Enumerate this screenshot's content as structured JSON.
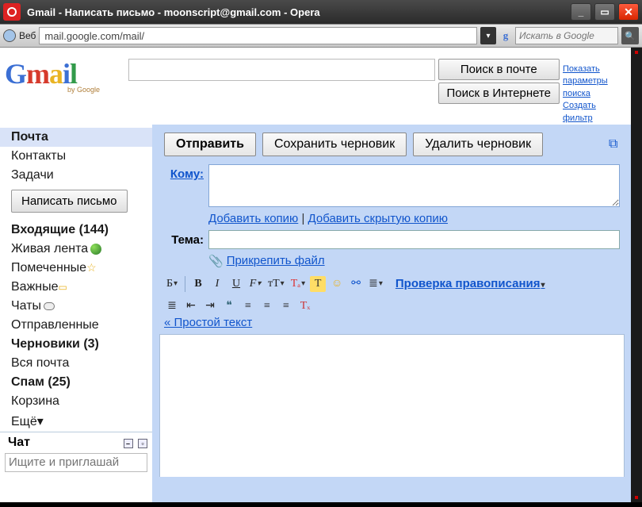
{
  "window": {
    "title": "Gmail - Написать письмо - moonscript@gmail.com - Opera"
  },
  "addressbar": {
    "label": "Веб",
    "url": "mail.google.com/mail/",
    "search_placeholder": "Искать в Google"
  },
  "logo": {
    "sub": "by Google"
  },
  "search_buttons": {
    "mail": "Поиск в почте",
    "web": "Поиск в Интернете"
  },
  "right_links": {
    "show_options": "Показать параметры поиска",
    "create_filter": "Создать фильтр"
  },
  "sidebar": {
    "nav1": [
      {
        "label": "Почта",
        "active": true
      },
      {
        "label": "Контакты"
      },
      {
        "label": "Задачи"
      }
    ],
    "compose": "Написать письмо",
    "nav2": [
      {
        "label": "Входящие (144)",
        "bold": true
      },
      {
        "label": "Живая лента",
        "icon": "globe"
      },
      {
        "label": "Помеченные",
        "icon": "star"
      },
      {
        "label": "Важные",
        "icon": "flag"
      },
      {
        "label": "Чаты",
        "icon": "bubble"
      },
      {
        "label": "Отправленные"
      },
      {
        "label": "Черновики (3)",
        "bold": true
      },
      {
        "label": "Вся почта"
      },
      {
        "label": "Спам (25)",
        "bold": true
      },
      {
        "label": "Корзина"
      },
      {
        "label": "Ещё▾"
      }
    ],
    "chat_header": "Чат",
    "chat_placeholder": "Ищите и приглашай"
  },
  "compose": {
    "send": "Отправить",
    "save_draft": "Сохранить черновик",
    "discard": "Удалить черновик",
    "to_label": "Кому:",
    "add_cc": "Добавить копию",
    "add_bcc": "Добавить скрытую копию",
    "subject_label": "Тема:",
    "attach": "Прикрепить файл",
    "spellcheck": "Проверка правописания",
    "plain_text": "« Простой текст"
  },
  "toolbar": {
    "font": "Б",
    "bold": "B",
    "italic": "I",
    "underline": "U",
    "fontface": "F",
    "fontsize": "тТ",
    "color": "Tₐ",
    "highlight": "T",
    "emoji": "☺",
    "link": "⚯",
    "numlist": "≣",
    "bullist": "≣",
    "outdent": "⇤",
    "indent": "⇥",
    "quote": "❝",
    "alignl": "≡",
    "alignc": "≡",
    "alignr": "≡",
    "clear": "Tₓ"
  }
}
